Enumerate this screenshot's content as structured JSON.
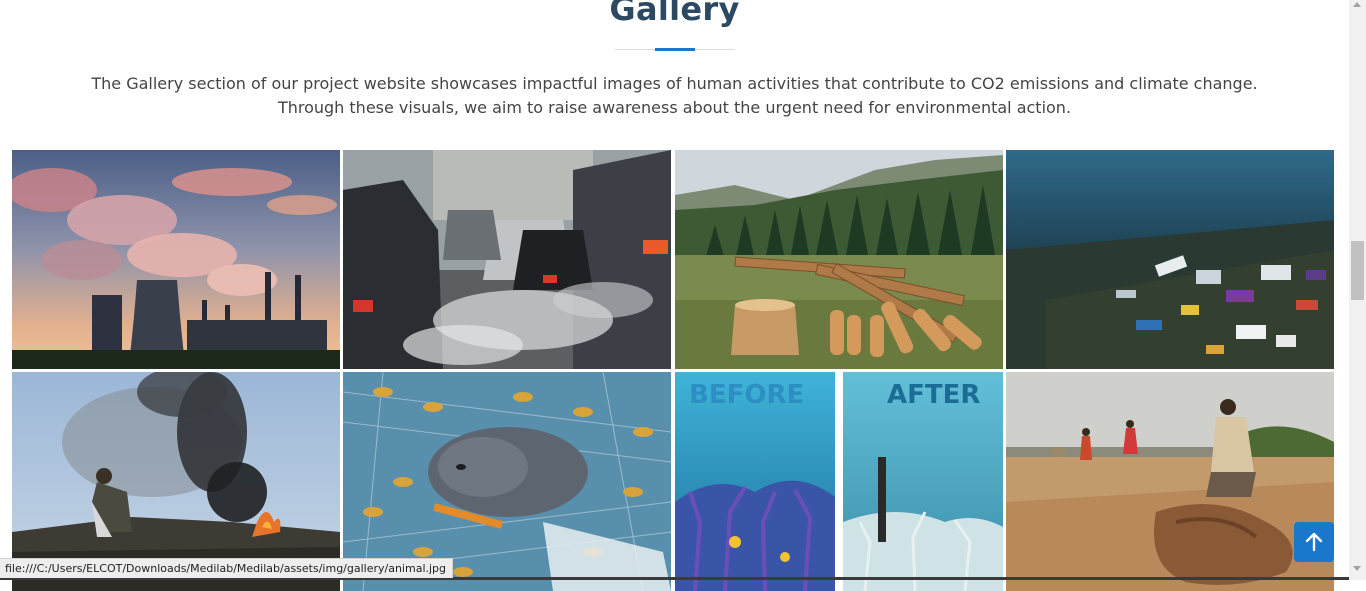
{
  "gallery": {
    "title": "Gallery",
    "intro_line1": "The Gallery section of our project website showcases impactful images of human activities that contribute to CO2 emissions and climate change.",
    "intro_line2": "Through these visuals, we aim to raise awareness about the urgent need for environmental action.",
    "images": [
      {
        "subject": "power plant smokestacks emitting smoke at sunset"
      },
      {
        "subject": "traffic jam with car exhaust fumes"
      },
      {
        "subject": "deforestation with cut logs and tree stump"
      },
      {
        "subject": "plastic pollution on the seabed"
      },
      {
        "subject": "person on burning garbage dump with black smoke"
      },
      {
        "subject": "seal entangled in fishing nets"
      },
      {
        "subject": "coral reef before and after bleaching",
        "label_before": "BEFORE",
        "label_after": "AFTER"
      },
      {
        "subject": "drought with dead animal and people on cracked land"
      }
    ]
  },
  "status_bar": {
    "url": "file:///C:/Users/ELCOT/Downloads/Medilab/Medilab/assets/img/gallery/animal.jpg"
  },
  "colors": {
    "title": "#2c4964",
    "accent": "#1977cc",
    "body_text": "#444444"
  },
  "icons": {
    "back_to_top": "arrow-up-icon"
  }
}
